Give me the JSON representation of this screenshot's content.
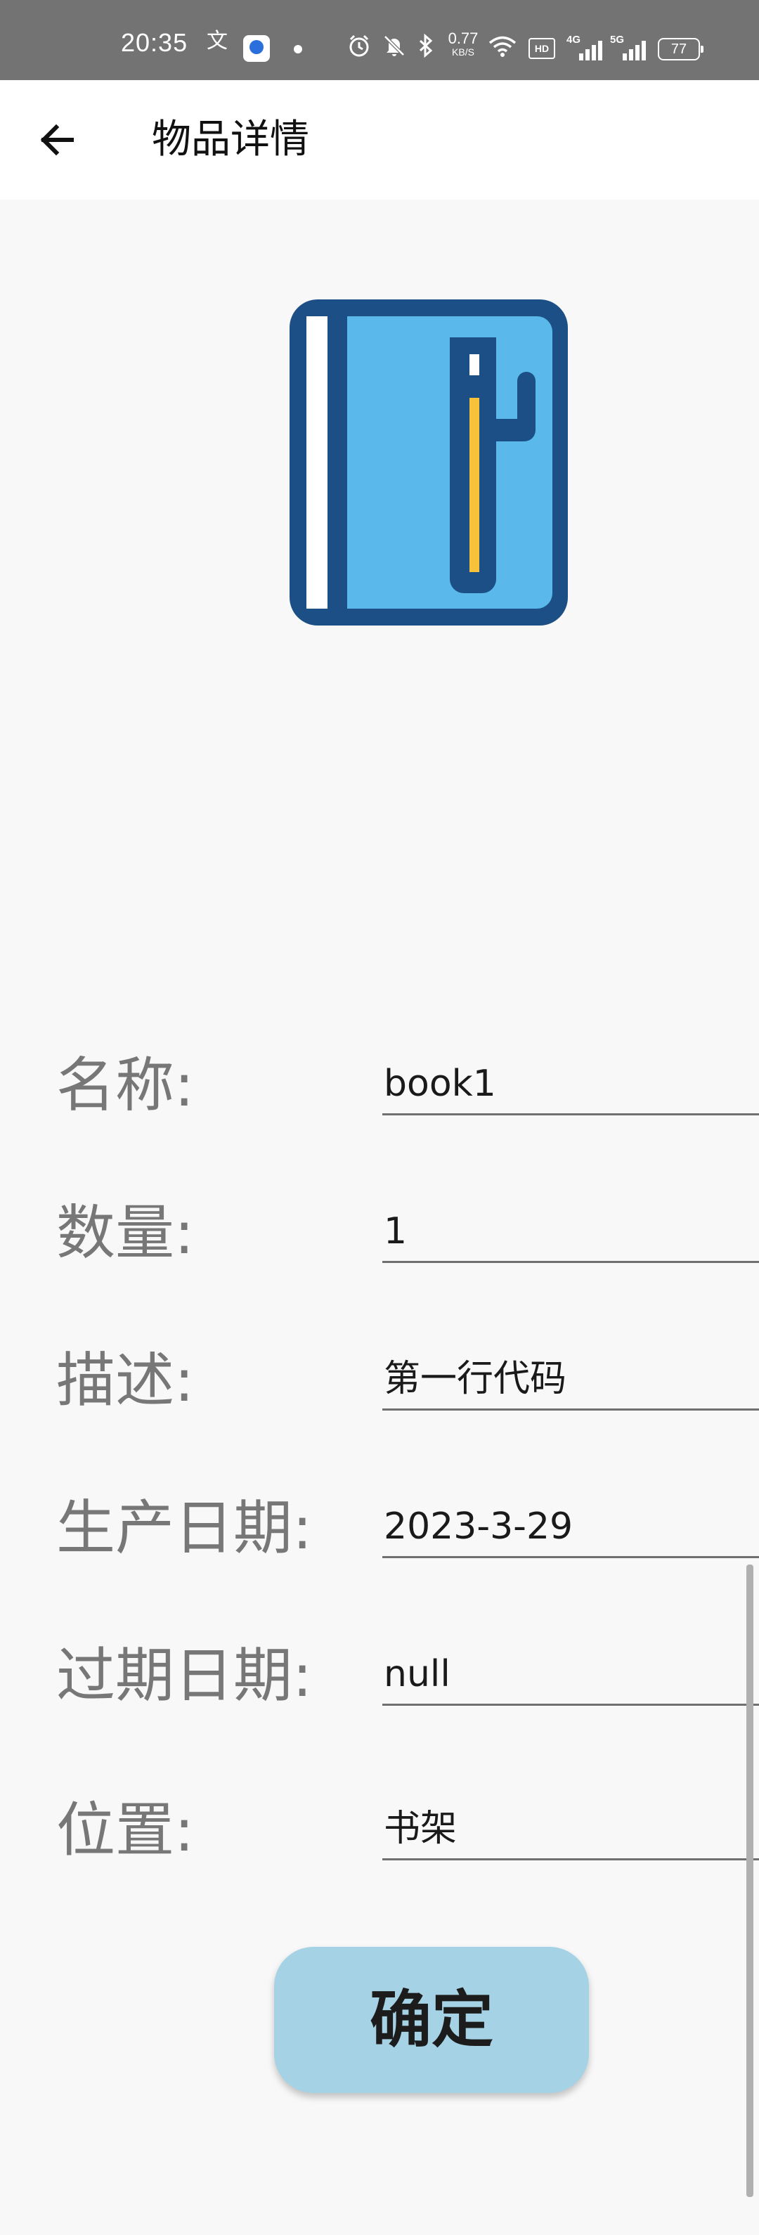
{
  "status_bar": {
    "time": "20:35",
    "translate_glyph": "文",
    "net_speed_value": "0.77",
    "net_speed_unit": "KB/S",
    "hd_label": "HD",
    "signal_1_label": "4G",
    "signal_2_label": "5G",
    "battery_level": "77",
    "icons": [
      "translate-icon",
      "app-notification-icon",
      "dot-icon",
      "alarm-icon",
      "mute-icon",
      "bluetooth-icon",
      "wifi-icon",
      "hd-icon",
      "signal-icon",
      "battery-icon"
    ]
  },
  "app_bar": {
    "back_icon": "arrow-left-icon",
    "title": "物品详情"
  },
  "item": {
    "image_icon": "notebook-pen-icon",
    "colors": {
      "cover_border": "#1c4f86",
      "cover_fill": "#5ab9ea",
      "spine": "#ffffff",
      "pen_accent": "#f7c23a"
    }
  },
  "form": {
    "rows": [
      {
        "label": "名称:",
        "value": "book1"
      },
      {
        "label": "数量:",
        "value": "1"
      },
      {
        "label": "描述:",
        "value": "第一行代码"
      },
      {
        "label": "生产日期:",
        "value": "2023-3-29"
      },
      {
        "label": "过期日期:",
        "value": "null"
      },
      {
        "label": "位置:",
        "value": "书架"
      }
    ]
  },
  "confirm_button": {
    "label": "确定",
    "color": "#a5d3e5"
  }
}
